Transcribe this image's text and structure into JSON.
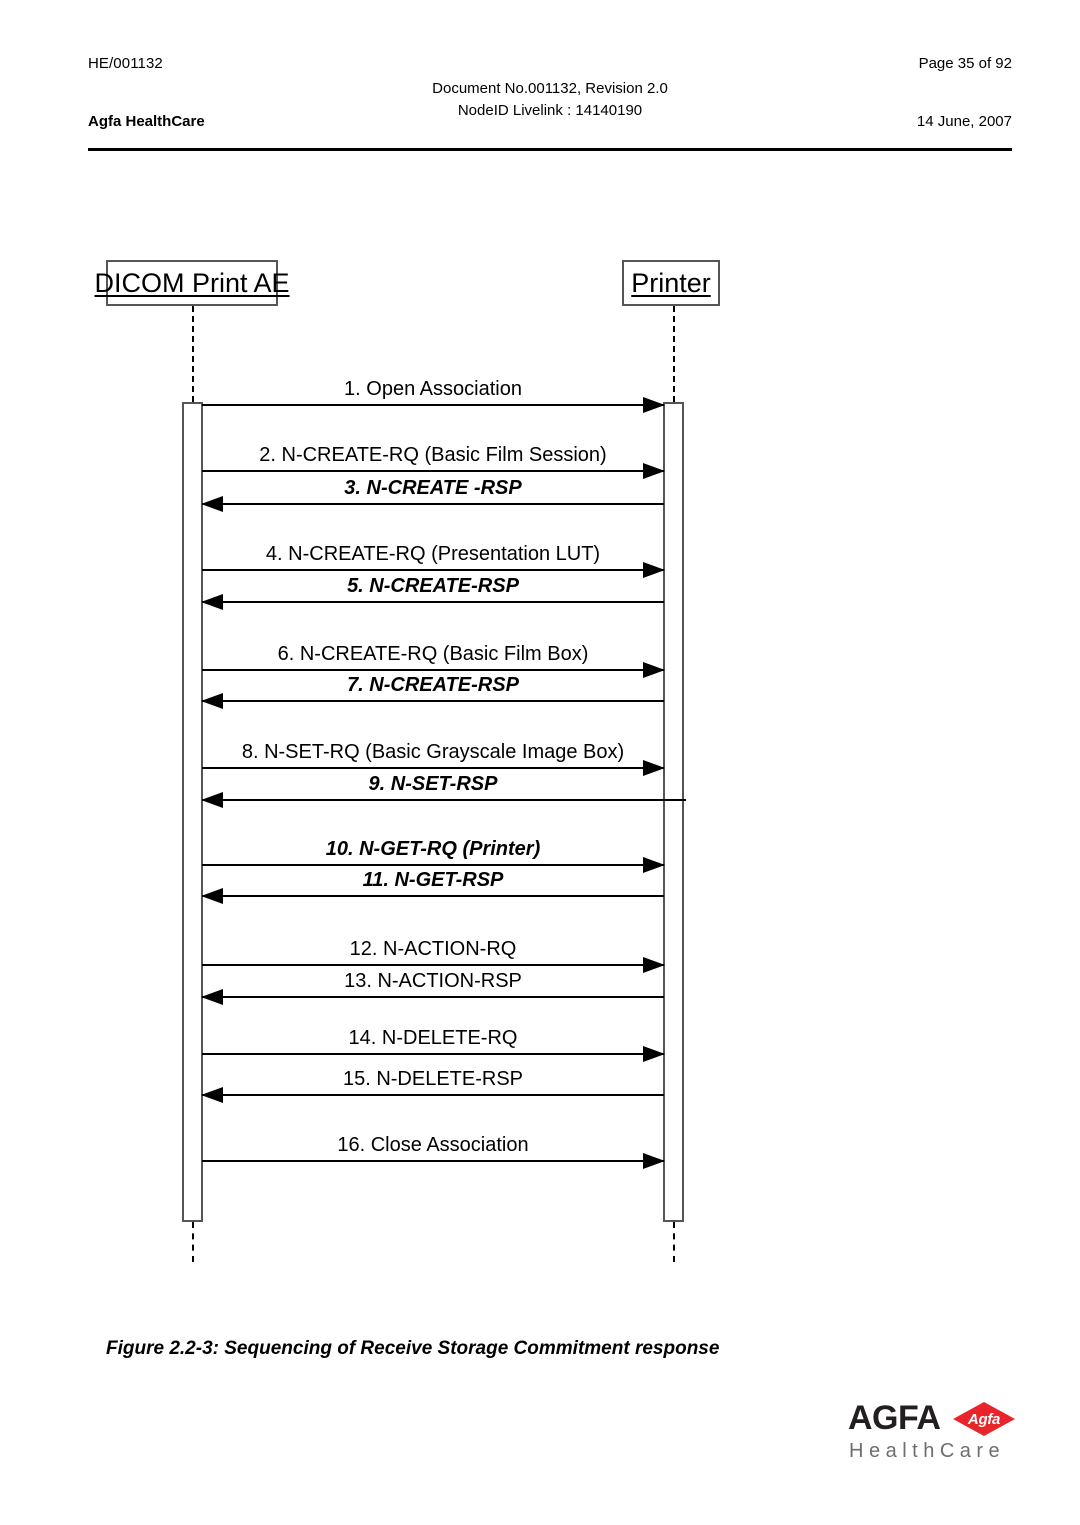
{
  "header": {
    "doc_id": "HE/001132",
    "page_number": "Page 35 of 92",
    "center_line1": "Document No.001132, Revision 2.0",
    "center_line2": "NodeID Livelink : 14140190",
    "company": "Agfa HealthCare",
    "date": "14 June, 2007"
  },
  "diagram": {
    "actors": [
      {
        "id": "dicom-print-ae",
        "label": "DICOM Print AE"
      },
      {
        "id": "printer",
        "label": "Printer"
      }
    ],
    "messages": [
      {
        "num": 1,
        "label": "1. Open Association",
        "direction": "to-right",
        "emphasis": false
      },
      {
        "num": 2,
        "label": "2. N-CREATE-RQ (Basic Film Session)",
        "direction": "to-right",
        "emphasis": false
      },
      {
        "num": 3,
        "label": "3. N-CREATE -RSP",
        "direction": "to-left",
        "emphasis": true
      },
      {
        "num": 4,
        "label": "4. N-CREATE-RQ (Presentation LUT)",
        "direction": "to-right",
        "emphasis": false
      },
      {
        "num": 5,
        "label": "5. N-CREATE-RSP",
        "direction": "to-left",
        "emphasis": true
      },
      {
        "num": 6,
        "label": "6. N-CREATE-RQ (Basic Film Box)",
        "direction": "to-right",
        "emphasis": false
      },
      {
        "num": 7,
        "label": "7. N-CREATE-RSP",
        "direction": "to-left",
        "emphasis": true
      },
      {
        "num": 8,
        "label": "8. N-SET-RQ (Basic Grayscale Image Box)",
        "direction": "to-right",
        "emphasis": false
      },
      {
        "num": 9,
        "label": "9. N-SET-RSP",
        "direction": "to-left",
        "emphasis": true
      },
      {
        "num": 10,
        "label": "10. N-GET-RQ (Printer)",
        "direction": "to-right",
        "emphasis": true
      },
      {
        "num": 11,
        "label": "11. N-GET-RSP",
        "direction": "to-left",
        "emphasis": true
      },
      {
        "num": 12,
        "label": "12. N-ACTION-RQ",
        "direction": "to-right",
        "emphasis": false
      },
      {
        "num": 13,
        "label": "13. N-ACTION-RSP",
        "direction": "to-left",
        "emphasis": false
      },
      {
        "num": 14,
        "label": "14. N-DELETE-RQ",
        "direction": "to-right",
        "emphasis": false
      },
      {
        "num": 15,
        "label": "15. N-DELETE-RSP",
        "direction": "to-left",
        "emphasis": false
      },
      {
        "num": 16,
        "label": "16. Close Association",
        "direction": "to-right",
        "emphasis": false
      }
    ]
  },
  "caption": {
    "text": "Figure 2.2-3: Sequencing of Receive Storage Commitment response"
  },
  "logo": {
    "wordmark": "AGFA",
    "diamond_label": "Agfa",
    "tagline": "HealthCare",
    "diamond_color": "#e8252a",
    "tagline_color": "#6b6f72",
    "wordmark_color": "#231f20"
  }
}
